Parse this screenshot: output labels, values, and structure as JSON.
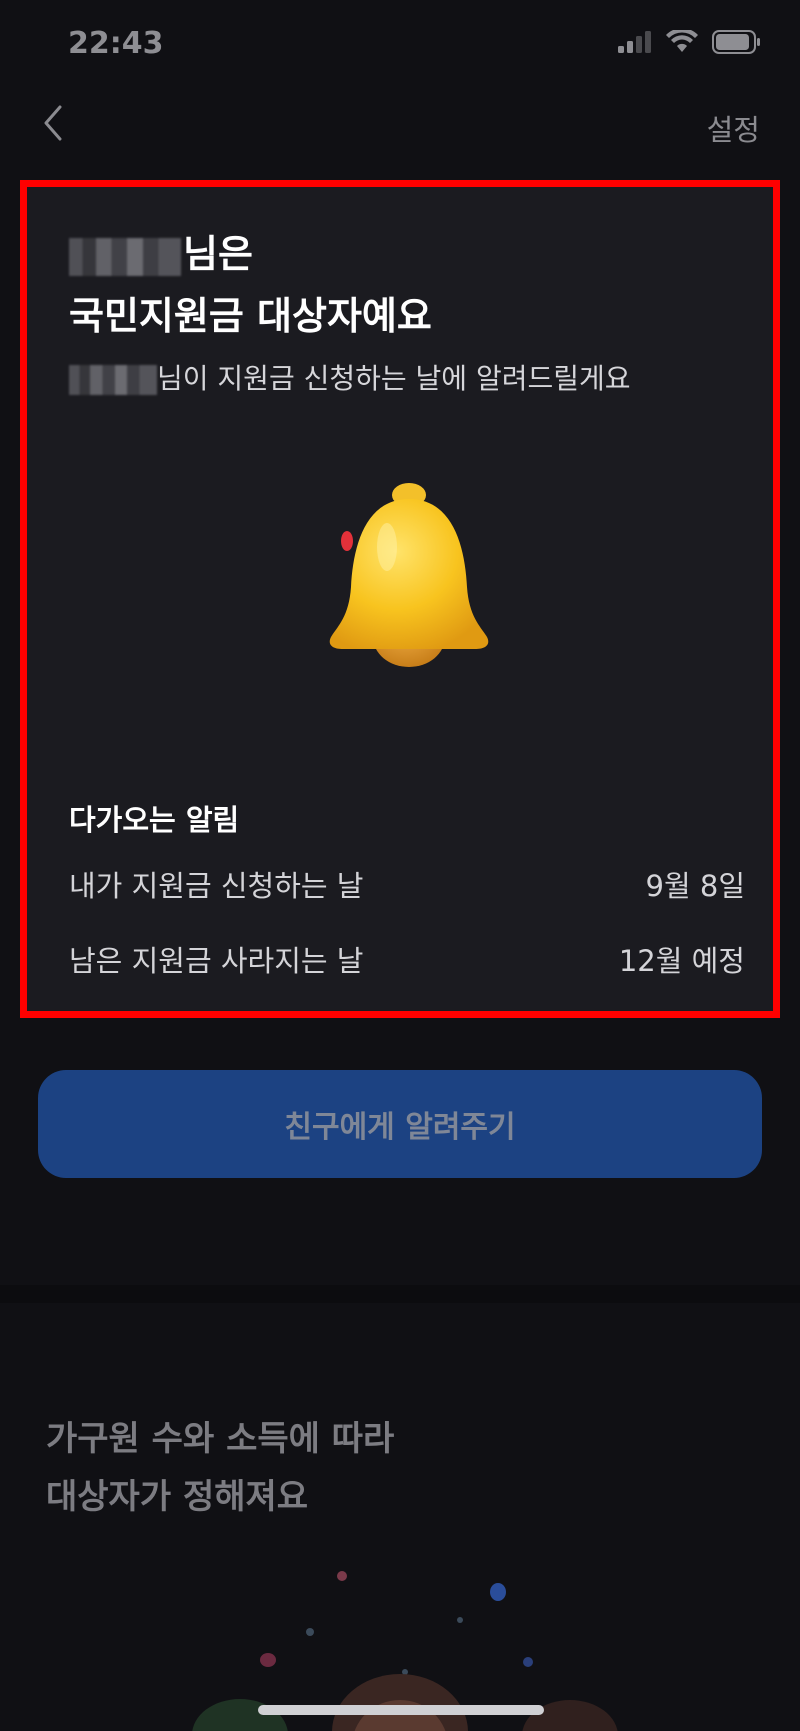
{
  "status_bar": {
    "time": "22:43"
  },
  "nav": {
    "settings_label": "설정"
  },
  "card": {
    "headline_suffix": "님은",
    "headline_line2": "국민지원금 대상자예요",
    "subline_suffix": "님이 지원금 신청하는 날에 알려드릴게요",
    "section_title": "다가오는 알림",
    "alerts": [
      {
        "label": "내가 지원금 신청하는 날",
        "value": "9월 8일"
      },
      {
        "label": "남은 지원금 사라지는 날",
        "value": "12월 예정"
      }
    ]
  },
  "share_button": {
    "label": "친구에게 알려주기"
  },
  "info": {
    "line1": "가구원 수와 소득에 따라",
    "line2": "대상자가 정해져요"
  },
  "colors": {
    "accent_button": "#1c4282",
    "highlight_border": "#ff0000",
    "bell": "#f7c625"
  },
  "icons": [
    "back-chevron-icon",
    "signal-icon",
    "wifi-icon",
    "battery-icon",
    "bell-icon"
  ]
}
